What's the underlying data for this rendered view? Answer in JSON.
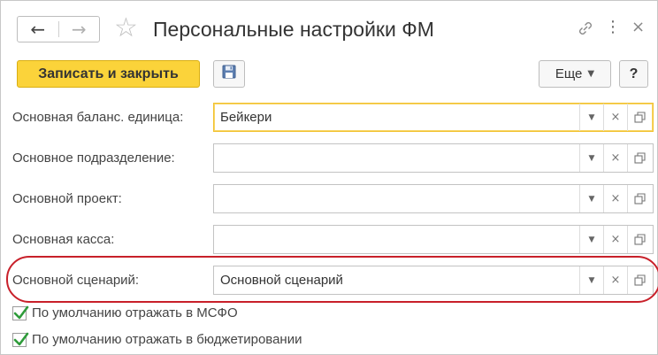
{
  "window": {
    "title": "Персональные настройки ФМ"
  },
  "toolbar": {
    "save_close_label": "Записать и закрыть",
    "more_label": "Еще",
    "help_label": "?"
  },
  "icons": {
    "back": "←",
    "forward": "→",
    "star": "☆",
    "more": "⋮",
    "close": "×",
    "dropdown": "▼",
    "clear": "×"
  },
  "form": {
    "rows": [
      {
        "label": "Основная баланс. единица:",
        "value": "Бейкери"
      },
      {
        "label": "Основное подразделение:",
        "value": ""
      },
      {
        "label": "Основной проект:",
        "value": ""
      },
      {
        "label": "Основная касса:",
        "value": ""
      },
      {
        "label": "Основной сценарий:",
        "value": "Основной сценарий"
      }
    ],
    "checkboxes": [
      {
        "label": "По умолчанию отражать в МСФО",
        "checked": true
      },
      {
        "label": "По умолчанию отражать в бюджетировании",
        "checked": true
      }
    ]
  },
  "colors": {
    "primary_button": "#fbd33a",
    "focus_border": "#f2c230",
    "highlight_oval": "#c8202a",
    "check_green": "#2e9b3a"
  }
}
